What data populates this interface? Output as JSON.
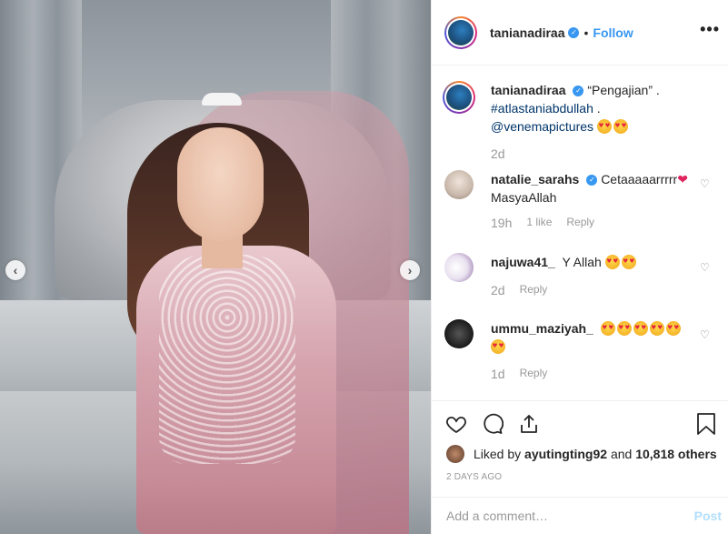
{
  "header": {
    "username": "tanianadiraa",
    "separator": "•",
    "follow_label": "Follow",
    "more_label": "•••"
  },
  "caption": {
    "username": "tanianadiraa",
    "text_quote": "“Pengajian” .",
    "hashtag": "#atlastaniabdullah",
    "after_hashtag": " .",
    "mention": "@venemapictures",
    "emoji_count": 2,
    "time": "2d"
  },
  "comments": [
    {
      "username": "natalie_sarahs",
      "verified": true,
      "text": "Cetaaaaarrrrr",
      "heart": "❤",
      "text2": "MasyaAllah",
      "time": "19h",
      "likes": "1 like",
      "reply": "Reply"
    },
    {
      "username": "najuwa41_",
      "verified": false,
      "text": "Y Allah",
      "emoji_count": 2,
      "time": "2d",
      "reply": "Reply"
    },
    {
      "username": "ummu_maziyah_",
      "verified": false,
      "emoji_count": 6,
      "time": "1d",
      "reply": "Reply"
    }
  ],
  "likes": {
    "prefix": "Liked by",
    "user": "ayutingting92",
    "middle": "and",
    "count_text": "10,818 others"
  },
  "posted_time": "2 DAYS AGO",
  "add_comment": {
    "placeholder": "Add a comment…",
    "post_label": "Post"
  },
  "colors": {
    "link": "#003569",
    "follow": "#3897f0",
    "muted": "#999999",
    "post_disabled": "#b2dffc"
  },
  "icons": [
    "chevron-left-icon",
    "chevron-right-icon",
    "verified-icon",
    "more-icon",
    "heart-icon",
    "comment-icon",
    "share-icon",
    "bookmark-icon"
  ]
}
